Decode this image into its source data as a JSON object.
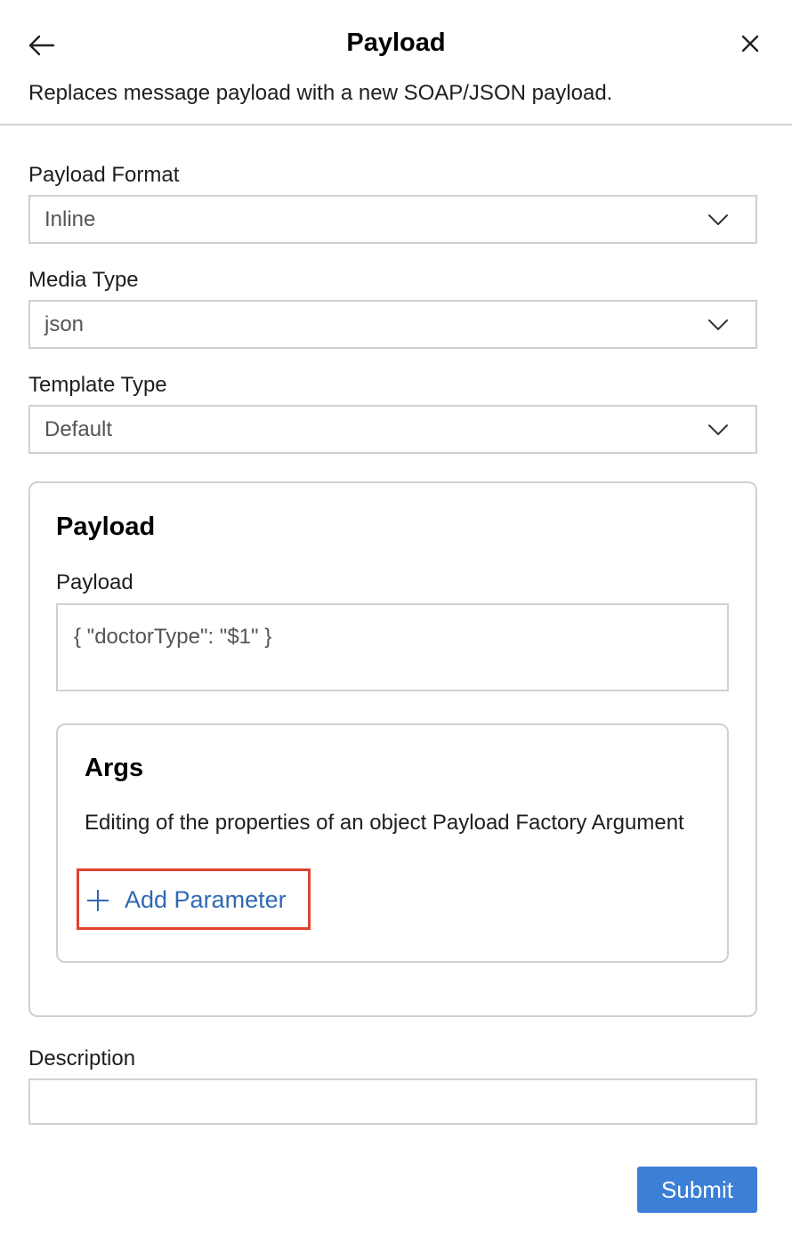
{
  "header": {
    "title": "Payload",
    "subtitle": "Replaces message payload with a new SOAP/JSON payload.",
    "back_icon": "arrow-left-icon",
    "close_icon": "close-icon"
  },
  "form": {
    "payload_format": {
      "label": "Payload Format",
      "value": "Inline"
    },
    "media_type": {
      "label": "Media Type",
      "value": "json"
    },
    "template_type": {
      "label": "Template Type",
      "value": "Default"
    },
    "payload_section": {
      "title": "Payload",
      "payload_label": "Payload",
      "payload_value": "{ \"doctorType\": \"$1\" }",
      "args": {
        "title": "Args",
        "description": "Editing of the properties of an object Payload Factory Argument",
        "add_button_label": "Add Parameter",
        "add_icon": "plus-icon"
      }
    },
    "description": {
      "label": "Description",
      "value": ""
    },
    "submit_label": "Submit"
  },
  "colors": {
    "accent": "#3b7fd6",
    "link": "#2f69b4",
    "highlight": "#e0432f",
    "border": "#d0d0d0"
  }
}
